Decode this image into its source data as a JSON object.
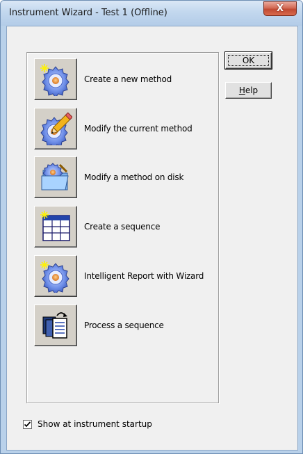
{
  "window": {
    "title": "Instrument Wizard - Test 1 (Offline)",
    "close_glyph": "X"
  },
  "buttons": {
    "ok_label": "OK",
    "help_label_prefix": "",
    "help_label_underlined": "H",
    "help_label_rest": "elp"
  },
  "items": [
    {
      "label": "Create a new method",
      "icon": "gear-sparkle-icon"
    },
    {
      "label": "Modify the current method",
      "icon": "gear-pencil-icon"
    },
    {
      "label": "Modify a method on disk",
      "icon": "folder-gear-icon"
    },
    {
      "label": "Create a sequence",
      "icon": "sequence-table-sparkle-icon"
    },
    {
      "label": "Intelligent Report with Wizard",
      "icon": "gear-sparkle-icon"
    },
    {
      "label": "Process a sequence",
      "icon": "process-documents-icon"
    }
  ],
  "startup": {
    "label": "Show at instrument startup",
    "checked": true
  },
  "colors": {
    "gear_blue": "#4a6fd0",
    "gear_center": "#e58a2a",
    "sparkle": "#ffee33",
    "title_bar": "#c2d7ee",
    "close_red": "#c04a33"
  }
}
